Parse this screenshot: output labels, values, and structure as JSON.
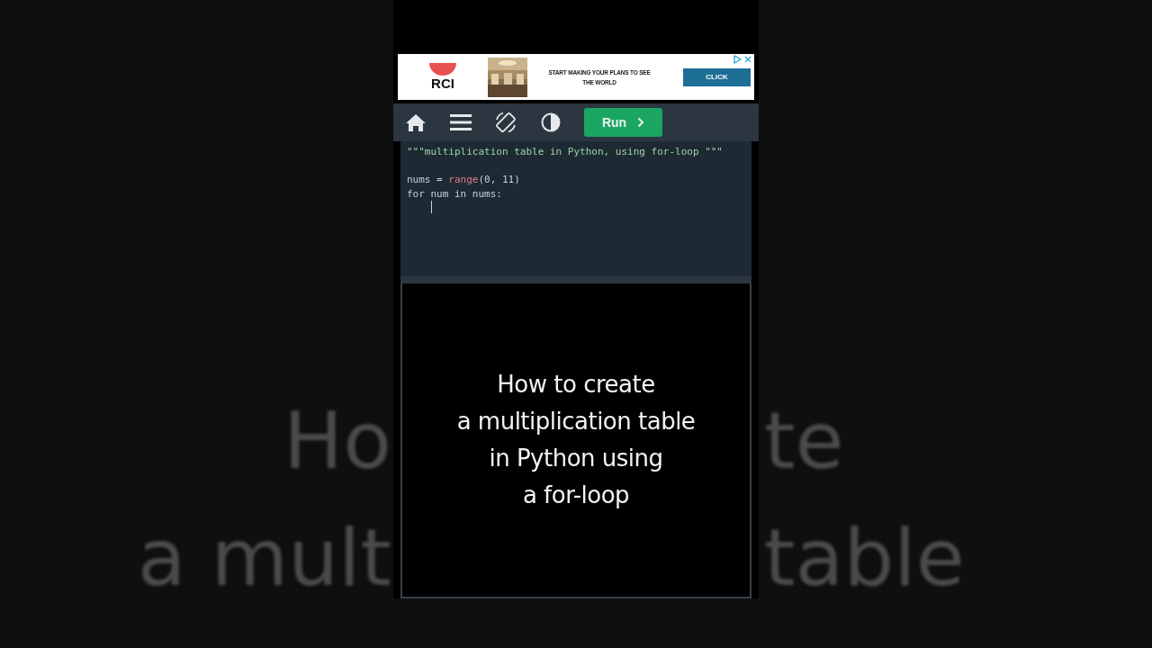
{
  "backdrop": {
    "lines": [
      {
        "left": "Ho",
        "right": "te"
      },
      {
        "left": "a mult",
        "right": "table"
      }
    ]
  },
  "ad": {
    "brand": "RCI",
    "headline": "START MAKING YOUR PLANS TO SEE",
    "headline_2": "THE WORLD",
    "button": "CLICK"
  },
  "toolbar": {
    "run_button": "Run"
  },
  "code": {
    "docstring": "\"\"\"multiplication table in Python, using for-loop \"\"\"",
    "lines": [
      {
        "tokens": [
          {
            "kind": "plain",
            "text": "nums = "
          },
          {
            "kind": "builtin",
            "text": "range"
          },
          {
            "kind": "plain",
            "text": "(0, 11)"
          }
        ]
      },
      {
        "tokens": [
          {
            "kind": "plain",
            "text": "for num in nums:"
          }
        ]
      }
    ]
  },
  "output": {
    "caption_lines": [
      "How to create",
      "a multiplication table",
      "in Python using",
      "a for-loop"
    ]
  }
}
